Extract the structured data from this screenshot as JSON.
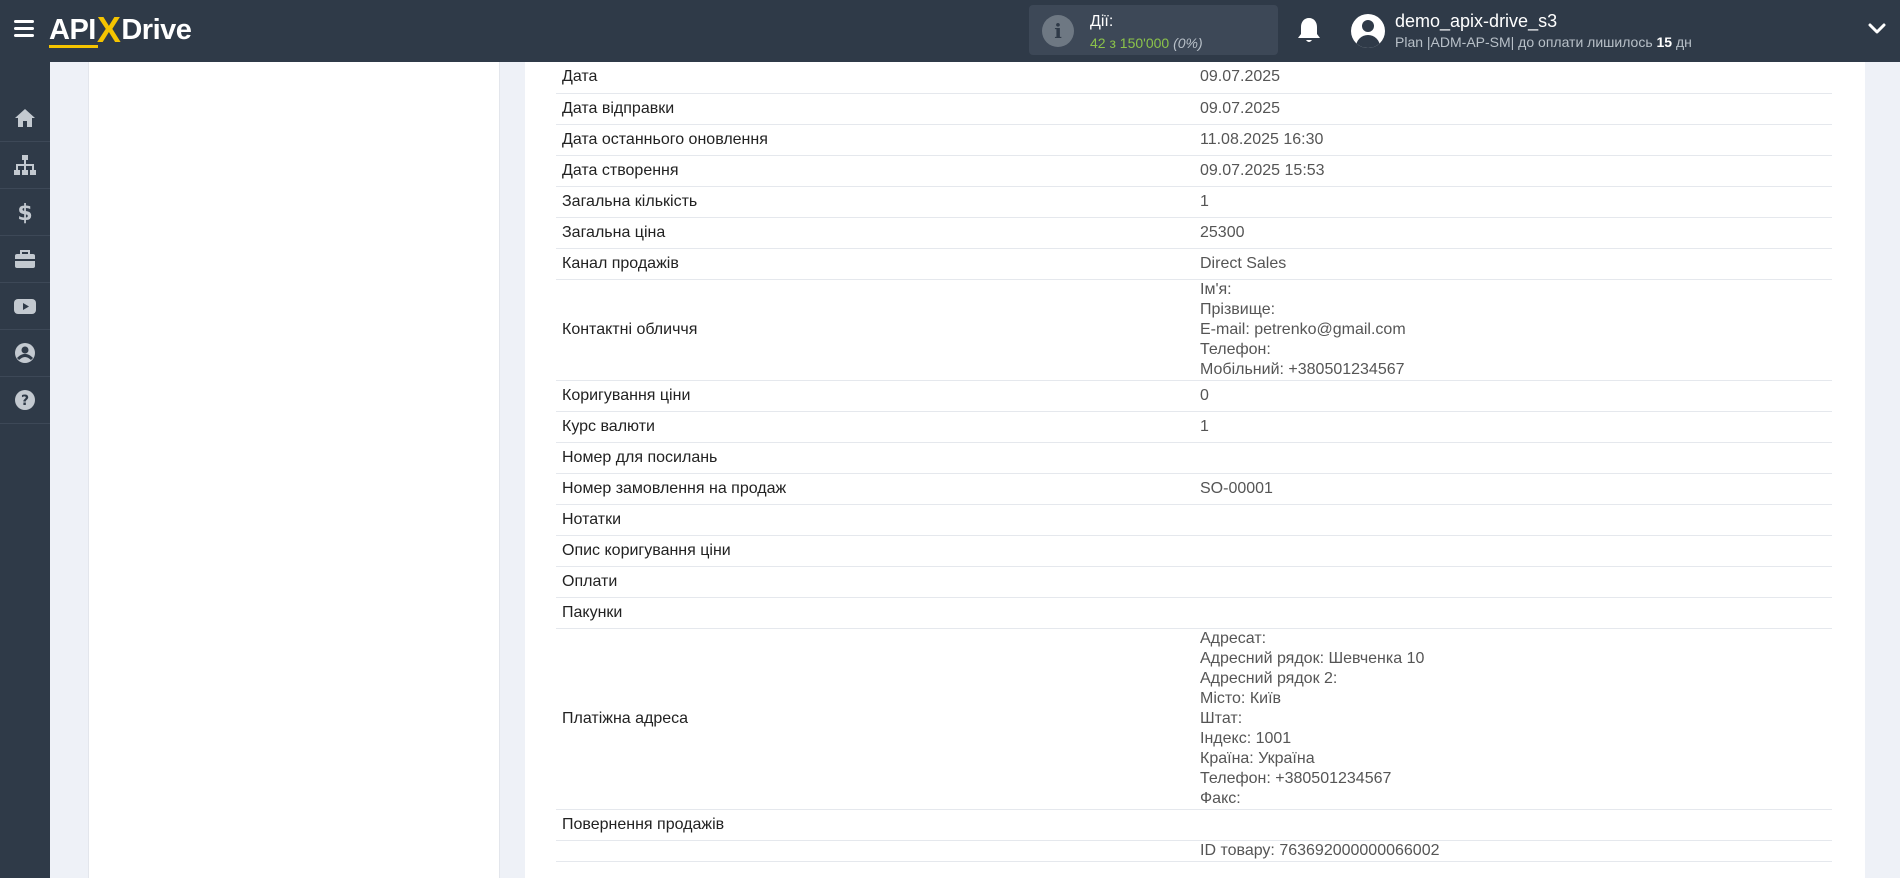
{
  "app": {
    "logo_left": "API",
    "logo_x": "X",
    "logo_right": "Drive"
  },
  "header": {
    "actions_label": "Дії:",
    "actions_count": "42",
    "actions_of": "з",
    "actions_limit": "150'000",
    "actions_percent": "(0%)",
    "user_name": "demo_apix-drive_s3",
    "plan_prefix": "Plan |ADM-AP-SM| до оплати лишилось",
    "plan_days": "15",
    "plan_suffix": "дн"
  },
  "sidebar": {
    "items": [
      {
        "icon": "home-icon"
      },
      {
        "icon": "sitemap-icon"
      },
      {
        "icon": "dollar-icon"
      },
      {
        "icon": "briefcase-icon"
      },
      {
        "icon": "youtube-icon"
      },
      {
        "icon": "user-circle-icon"
      },
      {
        "icon": "question-circle-icon"
      }
    ]
  },
  "rows": [
    {
      "key": "Дата",
      "value": "09.07.2025"
    },
    {
      "key": "Дата відправки",
      "value": "09.07.2025"
    },
    {
      "key": "Дата останнього оновлення",
      "value": "11.08.2025 16:30"
    },
    {
      "key": "Дата створення",
      "value": "09.07.2025 15:53"
    },
    {
      "key": "Загальна кількість",
      "value": "1"
    },
    {
      "key": "Загальна ціна",
      "value": "25300"
    },
    {
      "key": "Канал продажів",
      "value": "Direct Sales"
    },
    {
      "key": "Контактні обличчя",
      "lines": [
        "Ім'я:",
        "Прізвище:",
        "E-mail: petrenko@gmail.com",
        "Телефон:",
        "Мобільний: +380501234567"
      ]
    },
    {
      "key": "Коригування ціни",
      "value": "0"
    },
    {
      "key": "Курс валюти",
      "value": "1"
    },
    {
      "key": "Номер для посилань",
      "value": ""
    },
    {
      "key": "Номер замовлення на продаж",
      "value": "SO-00001"
    },
    {
      "key": "Нотатки",
      "value": ""
    },
    {
      "key": "Опис коригування ціни",
      "value": ""
    },
    {
      "key": "Оплати",
      "value": ""
    },
    {
      "key": "Пакунки",
      "value": ""
    },
    {
      "key": "Платіжна адреса",
      "lines": [
        "Адресат:",
        "Адресний рядок: Шевченка 10",
        "Адресний рядок 2:",
        "Місто: Київ",
        "Штат:",
        "Індекс: 1001",
        "Країна: Україна",
        "Телефон: +380501234567",
        "Факс:"
      ]
    },
    {
      "key": "Повернення продажів",
      "value": ""
    },
    {
      "key": "",
      "lines": [
        "ID товару: 763692000000066002"
      ]
    }
  ]
}
